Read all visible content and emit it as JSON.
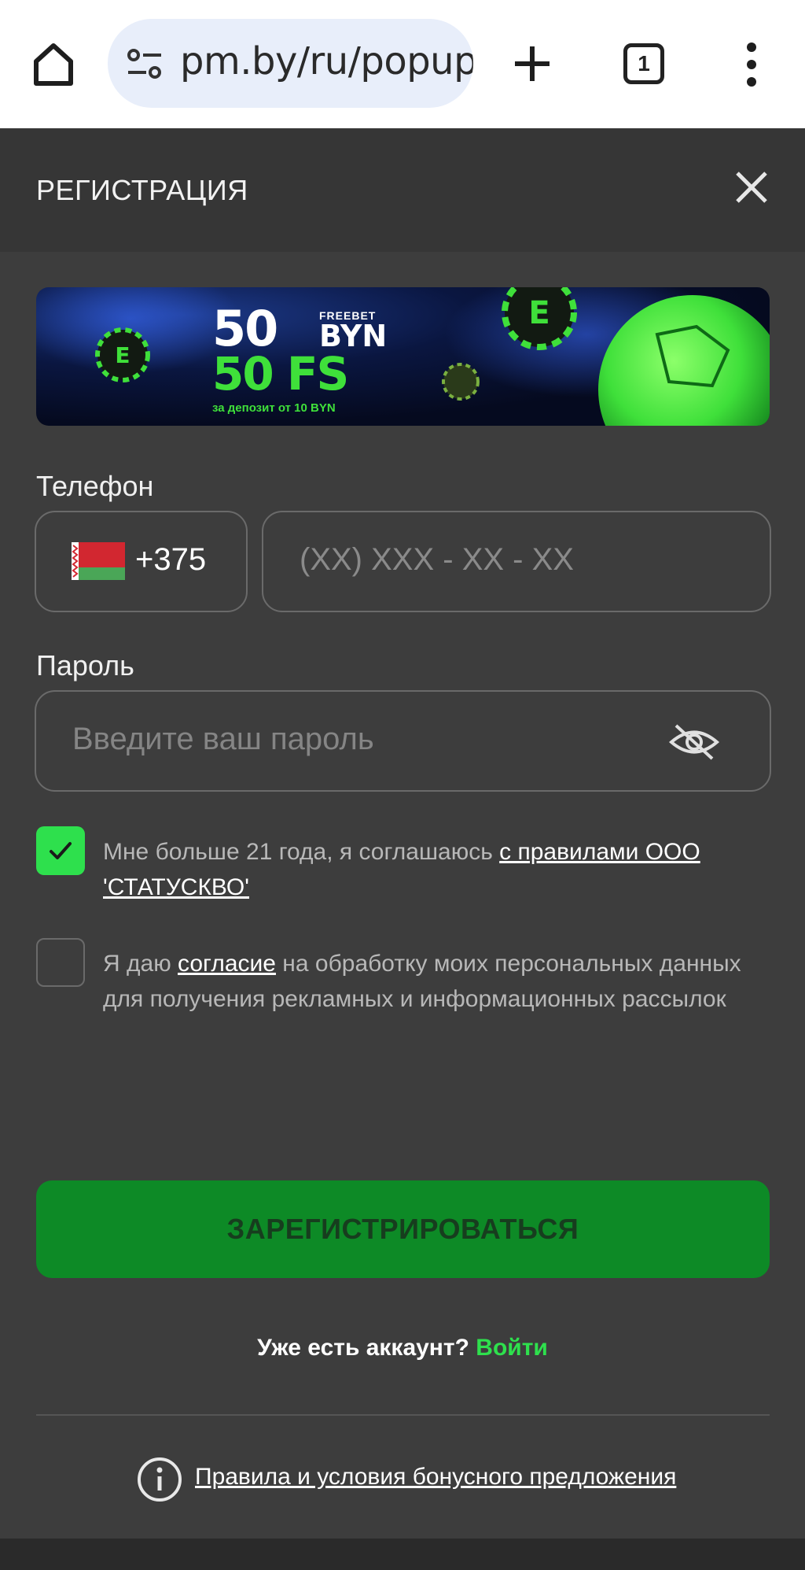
{
  "browser": {
    "url": "pm.by/ru/popup",
    "tab_count": "1"
  },
  "modal": {
    "title": "РЕГИСТРАЦИЯ"
  },
  "banner": {
    "amount": "50",
    "freebet": "FREEBET",
    "currency": "BYN",
    "fs": "50 FS",
    "deposit_note": "за депозит от 10 BYN"
  },
  "phone": {
    "label": "Телефон",
    "country_code": "+375",
    "placeholder": "(XX) XXX - XX - XX"
  },
  "password": {
    "label": "Пароль",
    "placeholder": "Введите ваш пароль"
  },
  "consent_age": {
    "checked": true,
    "text": "Мне больше 21 года, я соглашаюсь ",
    "link": "с правилами ООО 'СТАТУСКВО'"
  },
  "consent_marketing": {
    "checked": false,
    "text_before": "Я даю ",
    "link": "согласие",
    "text_after": " на обработку моих персональных данных для получения рекламных и информационных рассылок"
  },
  "register_button": "ЗАРЕГИСТРИРОВАТЬСЯ",
  "login": {
    "question": "Уже есть аккаунт? ",
    "link": "Войти"
  },
  "bonus_rules_link": "Правила и условия бонусного предложения",
  "colors": {
    "accent_green": "#2ee04d",
    "button_green": "#0d8a26",
    "background": "#3d3d3d",
    "header": "#363636"
  }
}
